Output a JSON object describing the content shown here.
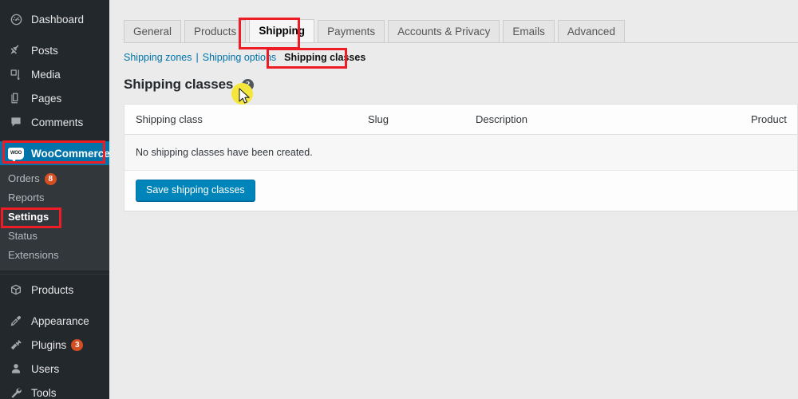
{
  "sidebar": {
    "items": [
      {
        "label": "Dashboard",
        "icon": "dashboard-icon",
        "current": false,
        "badge": null
      },
      {
        "label": "Posts",
        "icon": "pin-icon",
        "current": false,
        "badge": null
      },
      {
        "label": "Media",
        "icon": "media-icon",
        "current": false,
        "badge": null
      },
      {
        "label": "Pages",
        "icon": "pages-icon",
        "current": false,
        "badge": null
      },
      {
        "label": "Comments",
        "icon": "comment-icon",
        "current": false,
        "badge": null
      },
      {
        "label": "WooCommerce",
        "icon": "woocommerce-icon",
        "current": true,
        "badge": null
      },
      {
        "label": "Products",
        "icon": "products-icon",
        "current": false,
        "badge": null
      },
      {
        "label": "Appearance",
        "icon": "appearance-icon",
        "current": false,
        "badge": null
      },
      {
        "label": "Plugins",
        "icon": "plugins-icon",
        "current": false,
        "badge": "3"
      },
      {
        "label": "Users",
        "icon": "users-icon",
        "current": false,
        "badge": null
      },
      {
        "label": "Tools",
        "icon": "tools-icon",
        "current": false,
        "badge": null
      }
    ],
    "woocommerce_submenu": [
      {
        "label": "Orders",
        "current": false,
        "badge": "8"
      },
      {
        "label": "Reports",
        "current": false,
        "badge": null
      },
      {
        "label": "Settings",
        "current": true,
        "badge": null
      },
      {
        "label": "Status",
        "current": false,
        "badge": null
      },
      {
        "label": "Extensions",
        "current": false,
        "badge": null
      }
    ],
    "woo_icon_text": "WOO"
  },
  "tabs": [
    {
      "label": "General",
      "active": false
    },
    {
      "label": "Products",
      "active": false
    },
    {
      "label": "Shipping",
      "active": true
    },
    {
      "label": "Payments",
      "active": false
    },
    {
      "label": "Accounts & Privacy",
      "active": false
    },
    {
      "label": "Emails",
      "active": false
    },
    {
      "label": "Advanced",
      "active": false
    }
  ],
  "subnav": {
    "zones": "Shipping zones",
    "separator": "|",
    "options": "Shipping options",
    "classes": "Shipping classes"
  },
  "heading": {
    "title": "Shipping classes",
    "help_glyph": "?"
  },
  "table": {
    "columns": {
      "shipping_class": "Shipping class",
      "slug": "Slug",
      "description": "Description",
      "product_count": "Product"
    },
    "empty_message": "No shipping classes have been created.",
    "rows": []
  },
  "footer": {
    "save_button": "Save shipping classes"
  },
  "colors": {
    "sidebar_bg": "#23282d",
    "submenu_bg": "#32373c",
    "current_highlight": "#0073aa",
    "badge": "#d54e21",
    "annotation_red": "#ee1c25",
    "click_highlight": "#f5e63c",
    "primary_button": "#0085ba",
    "link_blue": "#0073aa",
    "page_bg": "#ebebeb"
  }
}
